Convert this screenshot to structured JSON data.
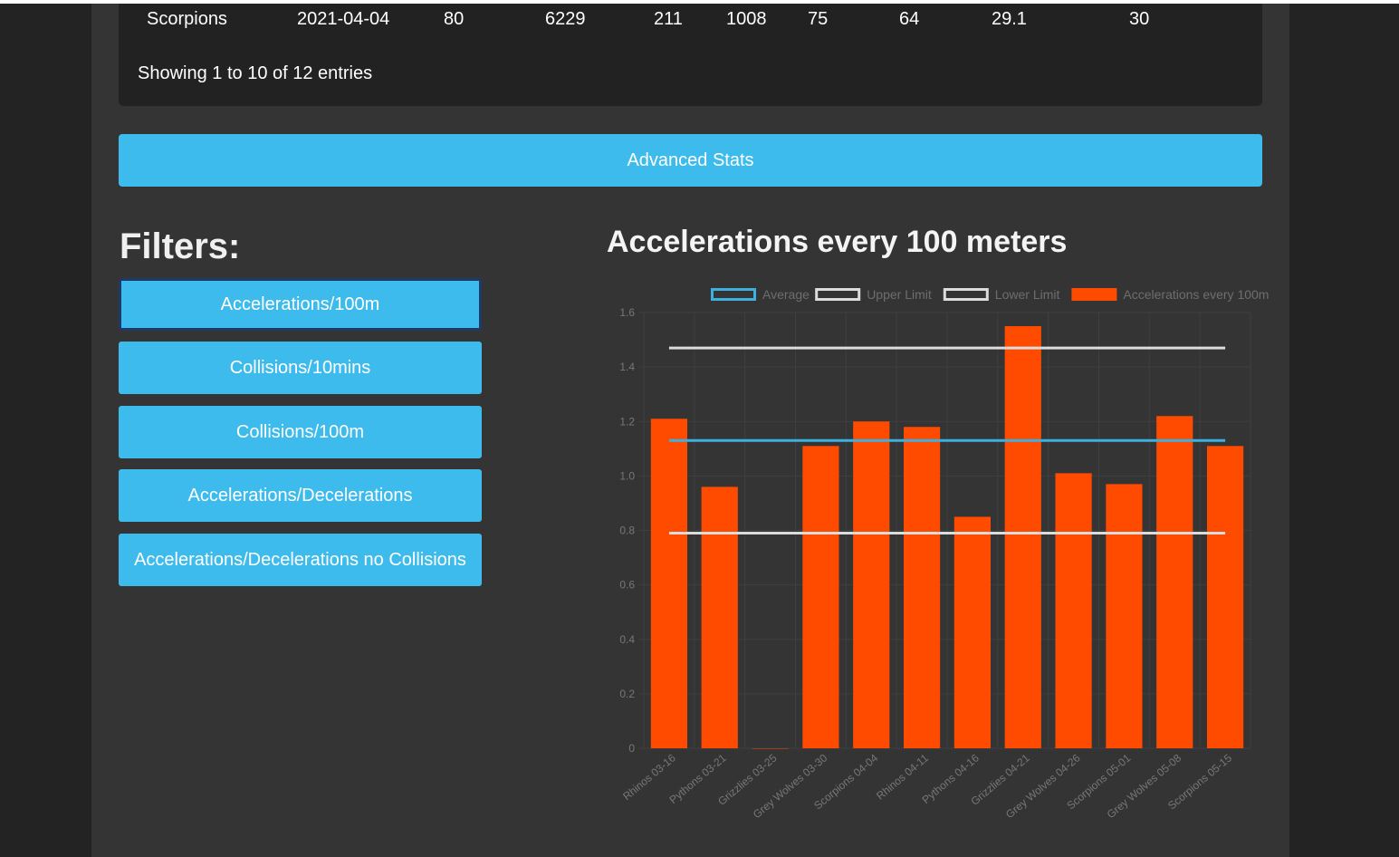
{
  "table": {
    "last_row": [
      "Scorpions",
      "2021-04-04",
      "80",
      "6229",
      "211",
      "1008",
      "75",
      "64",
      "29.1",
      "30"
    ],
    "showing_text": "Showing 1 to 10 of 12 entries"
  },
  "advanced_stats_label": "Advanced Stats",
  "filters": {
    "title": "Filters:",
    "buttons": [
      "Accelerations/100m",
      "Collisions/10mins",
      "Collisions/100m",
      "Accelerations/Decelerations",
      "Accelerations/Decelerations no Collisions"
    ]
  },
  "colors": {
    "accent": "#3dbbec",
    "bar": "#ff4b00",
    "average_line": "#3db0e0",
    "limit_line": "#dcdcdc",
    "background": "#343434"
  },
  "chart_data": {
    "type": "bar",
    "title": "Accelerations every 100 meters",
    "categories": [
      "Rhinos 03-16",
      "Pythons 03-21",
      "Grizzlies 03-25",
      "Grey Wolves 03-30",
      "Scorpions 04-04",
      "Rhinos 04-11",
      "Pythons 04-16",
      "Grizzlies 04-21",
      "Grey Wolves 04-26",
      "Scorpions 05-01",
      "Grey Wolves 05-08",
      "Scorpions 05-15"
    ],
    "series": [
      {
        "name": "Accelerations every 100m",
        "values": [
          1.21,
          0.96,
          0.0,
          1.11,
          1.2,
          1.18,
          0.85,
          1.55,
          1.01,
          0.97,
          1.22,
          1.11
        ]
      }
    ],
    "lines": [
      {
        "name": "Average",
        "value": 1.13
      },
      {
        "name": "Upper Limit",
        "value": 1.47
      },
      {
        "name": "Lower Limit",
        "value": 0.79
      }
    ],
    "legend": [
      "Average",
      "Upper Limit",
      "Lower Limit",
      "Accelerations every 100m"
    ],
    "ylim": [
      0,
      1.6
    ],
    "yticks": [
      "0",
      "0.2",
      "0.4",
      "0.6",
      "0.8",
      "1.0",
      "1.2",
      "1.4",
      "1.6"
    ],
    "grid": true,
    "legend_position": "top"
  }
}
